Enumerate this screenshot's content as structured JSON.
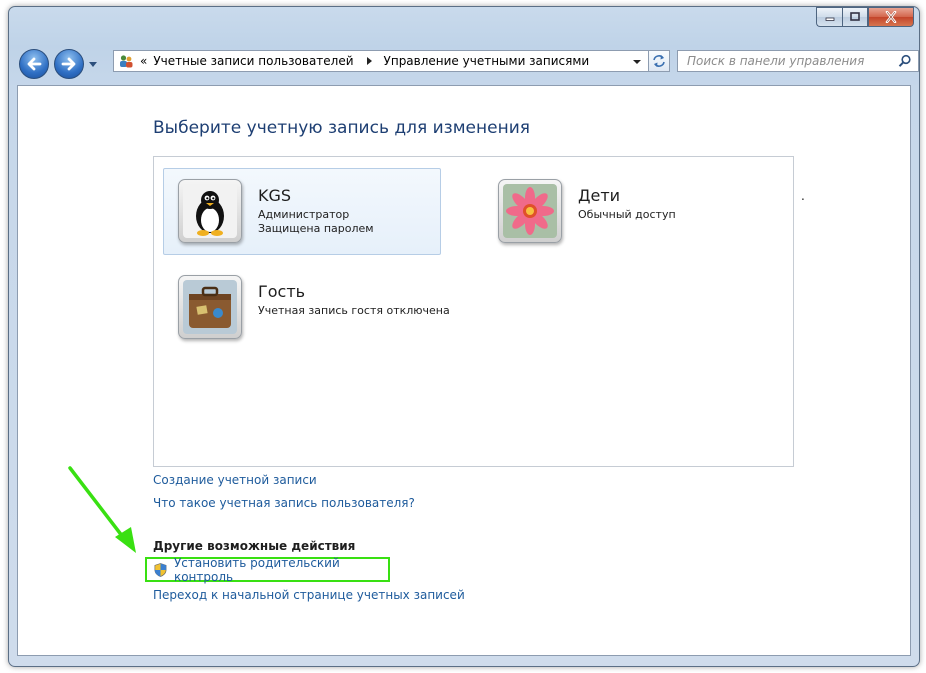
{
  "window": {
    "caption_buttons": [
      "minimize-icon",
      "maximize-icon",
      "close-icon"
    ]
  },
  "nav": {
    "address": {
      "root_glyph": "«",
      "crumbs": [
        "Учетные записи пользователей",
        "Управление учетными записями"
      ]
    },
    "search_placeholder": "Поиск в панели управления"
  },
  "main": {
    "heading": "Выберите учетную запись для изменения",
    "accounts": [
      {
        "name": "KGS",
        "lines": [
          "Администратор",
          "Защищена паролем"
        ],
        "picture": "penguin-icon",
        "selected": true
      },
      {
        "name": "Дети",
        "lines": [
          "Обычный доступ"
        ],
        "picture": "flower-icon",
        "selected": false
      },
      {
        "name": "Гость",
        "lines": [
          "Учетная запись гостя отключена"
        ],
        "picture": "suitcase-icon",
        "selected": false
      }
    ],
    "links": [
      "Создание учетной записи",
      "Что такое учетная запись пользователя?"
    ],
    "other_actions_title": "Другие возможные действия",
    "parental_control": "Установить родительский контроль",
    "back_link": "Переход к начальной странице учетных записей",
    "stray_mark": "."
  },
  "colors": {
    "link": "#1e5b9c",
    "heading": "#1e3f73",
    "highlight": "#39e012",
    "close_button": "#c3442a"
  }
}
